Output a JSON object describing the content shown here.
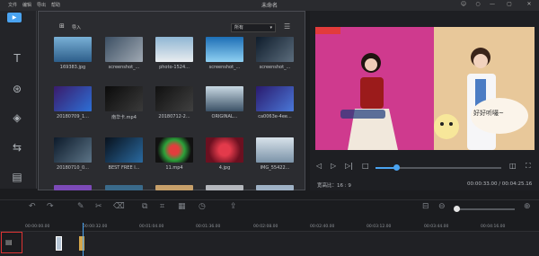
{
  "menu": [
    "文件",
    "编辑",
    "导出",
    "帮助"
  ],
  "window": {
    "title": "未命名"
  },
  "win_controls": [
    "☺",
    "○",
    "—",
    "▢",
    "✕"
  ],
  "sidebar": {
    "media_label": "▶",
    "items": [
      {
        "name": "text",
        "glyph": "T"
      },
      {
        "name": "filters",
        "glyph": "⊛"
      },
      {
        "name": "overlays",
        "glyph": "◈"
      },
      {
        "name": "transitions",
        "glyph": "⇆"
      },
      {
        "name": "elements",
        "glyph": "▤"
      }
    ]
  },
  "library": {
    "import_label": "导入",
    "filter_value": "所有",
    "items": [
      {
        "caption": "169383.jpg"
      },
      {
        "caption": "screenshot_..."
      },
      {
        "caption": "photo-1524..."
      },
      {
        "caption": "screenshot_..."
      },
      {
        "caption": "screenshot_..."
      },
      {
        "caption": "20180709_1..."
      },
      {
        "caption": "南华卡.mp4"
      },
      {
        "caption": "20180712-2..."
      },
      {
        "caption": "ORIGINAL..."
      },
      {
        "caption": "ca0063e-4ee..."
      },
      {
        "caption": "20180710_0..."
      },
      {
        "caption": "BEST FREE I..."
      },
      {
        "caption": "11.mp4"
      },
      {
        "caption": "4.jpg"
      },
      {
        "caption": "IMG_55422..."
      }
    ]
  },
  "preview": {
    "ratio_label": "宽高比：16 : 9",
    "timecode": "00:00:33.00 / 00:04:25.16",
    "overlay_text": "好好听嘬~",
    "progress": 0.14
  },
  "timeline": {
    "ticks": [
      "00:00:00.00",
      "00:00:32.00",
      "00:01:04.00",
      "00:01:36.00",
      "00:02:08.00",
      "00:02:40.00",
      "00:03:12.00",
      "00:03:44.00",
      "00:04:16.00"
    ],
    "zoom_level": 0.05
  },
  "colors": {
    "accent": "#4aa3f0",
    "selection": "#dd3333"
  }
}
